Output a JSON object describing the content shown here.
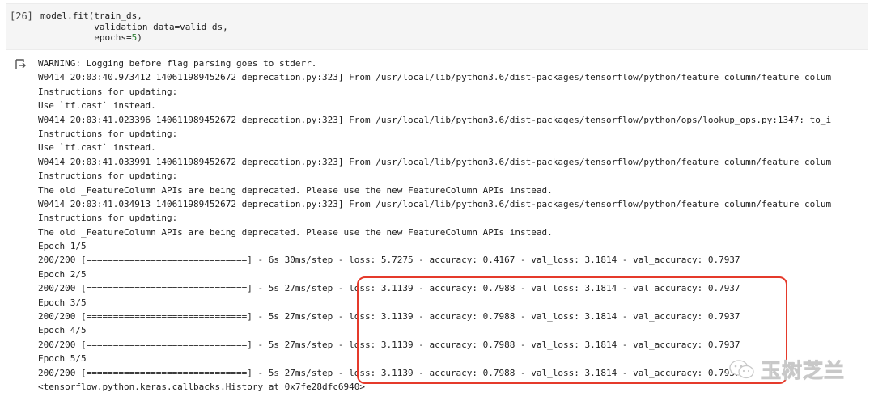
{
  "cell": {
    "prompt": "[26]",
    "code_lines": [
      "model.fit(train_ds,",
      "          validation_data=valid_ds,",
      "          epochs=5)"
    ]
  },
  "output": {
    "icon": "output-arrow-icon",
    "lines": [
      "WARNING: Logging before flag parsing goes to stderr.",
      "W0414 20:03:40.973412 140611989452672 deprecation.py:323] From /usr/local/lib/python3.6/dist-packages/tensorflow/python/feature_column/feature_colum",
      "Instructions for updating:",
      "Use `tf.cast` instead.",
      "W0414 20:03:41.023396 140611989452672 deprecation.py:323] From /usr/local/lib/python3.6/dist-packages/tensorflow/python/ops/lookup_ops.py:1347: to_i",
      "Instructions for updating:",
      "Use `tf.cast` instead.",
      "W0414 20:03:41.033991 140611989452672 deprecation.py:323] From /usr/local/lib/python3.6/dist-packages/tensorflow/python/feature_column/feature_colum",
      "Instructions for updating:",
      "The old _FeatureColumn APIs are being deprecated. Please use the new FeatureColumn APIs instead.",
      "W0414 20:03:41.034913 140611989452672 deprecation.py:323] From /usr/local/lib/python3.6/dist-packages/tensorflow/python/feature_column/feature_colum",
      "Instructions for updating:",
      "The old _FeatureColumn APIs are being deprecated. Please use the new FeatureColumn APIs instead.",
      "Epoch 1/5",
      "200/200 [==============================] - 6s 30ms/step - loss: 5.7275 - accuracy: 0.4167 - val_loss: 3.1814 - val_accuracy: 0.7937",
      "Epoch 2/5",
      "200/200 [==============================] - 5s 27ms/step - loss: 3.1139 - accuracy: 0.7988 - val_loss: 3.1814 - val_accuracy: 0.7937",
      "Epoch 3/5",
      "200/200 [==============================] - 5s 27ms/step - loss: 3.1139 - accuracy: 0.7988 - val_loss: 3.1814 - val_accuracy: 0.7937",
      "Epoch 4/5",
      "200/200 [==============================] - 5s 27ms/step - loss: 3.1139 - accuracy: 0.7988 - val_loss: 3.1814 - val_accuracy: 0.7937",
      "Epoch 5/5",
      "200/200 [==============================] - 5s 27ms/step - loss: 3.1139 - accuracy: 0.7988 - val_loss: 3.1814 - val_accuracy: 0.7937",
      "<tensorflow.python.keras.callbacks.History at 0x7fe28dfc6940>"
    ]
  },
  "highlight": {
    "color": "#e53a2b"
  },
  "watermark": {
    "text": "玉树芝兰",
    "icon": "wechat-icon"
  }
}
